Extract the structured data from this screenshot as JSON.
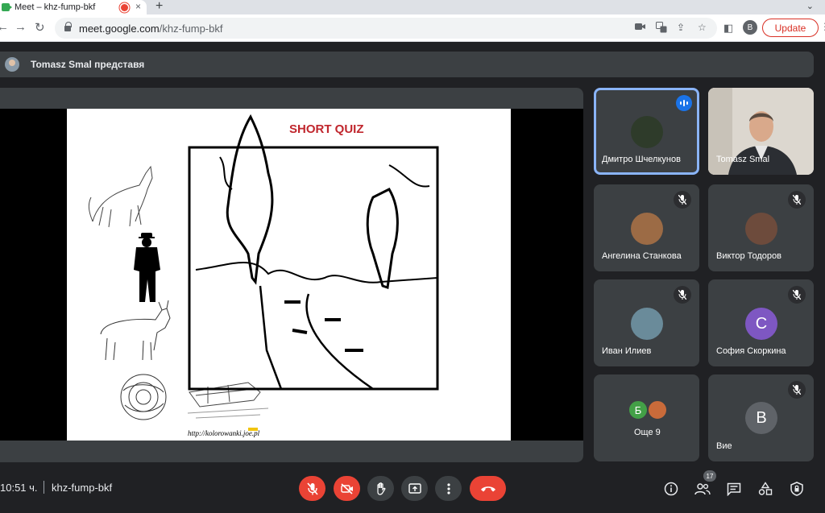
{
  "browser": {
    "tab_title": "Meet – khz-fump-bkf",
    "close_glyph": "×",
    "new_tab_glyph": "+",
    "tab_menu_glyph": "⌄",
    "url_host": "meet.google.com",
    "url_path": "/khz-fump-bkf",
    "profile_initial": "B",
    "update_label": "Update",
    "back_glyph": "←",
    "forward_glyph": "→",
    "reload_glyph": "↻",
    "star_glyph": "☆",
    "share_glyph": "⇪",
    "sidebar_glyph": "◧",
    "menu_glyph": "⋮"
  },
  "presenter": {
    "text": "Tomasz Smal представя"
  },
  "slide": {
    "title": "SHORT QUIZ",
    "footer": "http://kolorowanki.joe.pl"
  },
  "participants": [
    {
      "name": "Дмитро Шчелкунов",
      "speaking": true,
      "avatar_color": "#2e3b2a"
    },
    {
      "name": "Tomasz Smal",
      "video": true
    },
    {
      "name": "Ангелина Станкова",
      "muted": true,
      "avatar_color": "#9c6b45"
    },
    {
      "name": "Виктор Тодоров",
      "muted": true,
      "avatar_color": "#6d4b3c"
    },
    {
      "name": "Иван Илиев",
      "muted": true,
      "avatar_color": "#6a8b9a"
    },
    {
      "name": "София Скоркина",
      "muted": true,
      "initial": "С",
      "avatar_color": "#7e57c2"
    },
    {
      "name": "Още 9",
      "initial": "Б",
      "avatar_color": "#43a047"
    },
    {
      "name": "Вие",
      "muted": true,
      "initial": "В",
      "avatar_color": "#5f6368"
    }
  ],
  "controls": {
    "time": "10:51 ч.",
    "meeting_code": "khz-fump-bkf",
    "people_count": "17"
  },
  "colors": {
    "background": "#202124",
    "tile": "#3c4043",
    "danger": "#ea4335",
    "accent": "#8ab4f8"
  }
}
